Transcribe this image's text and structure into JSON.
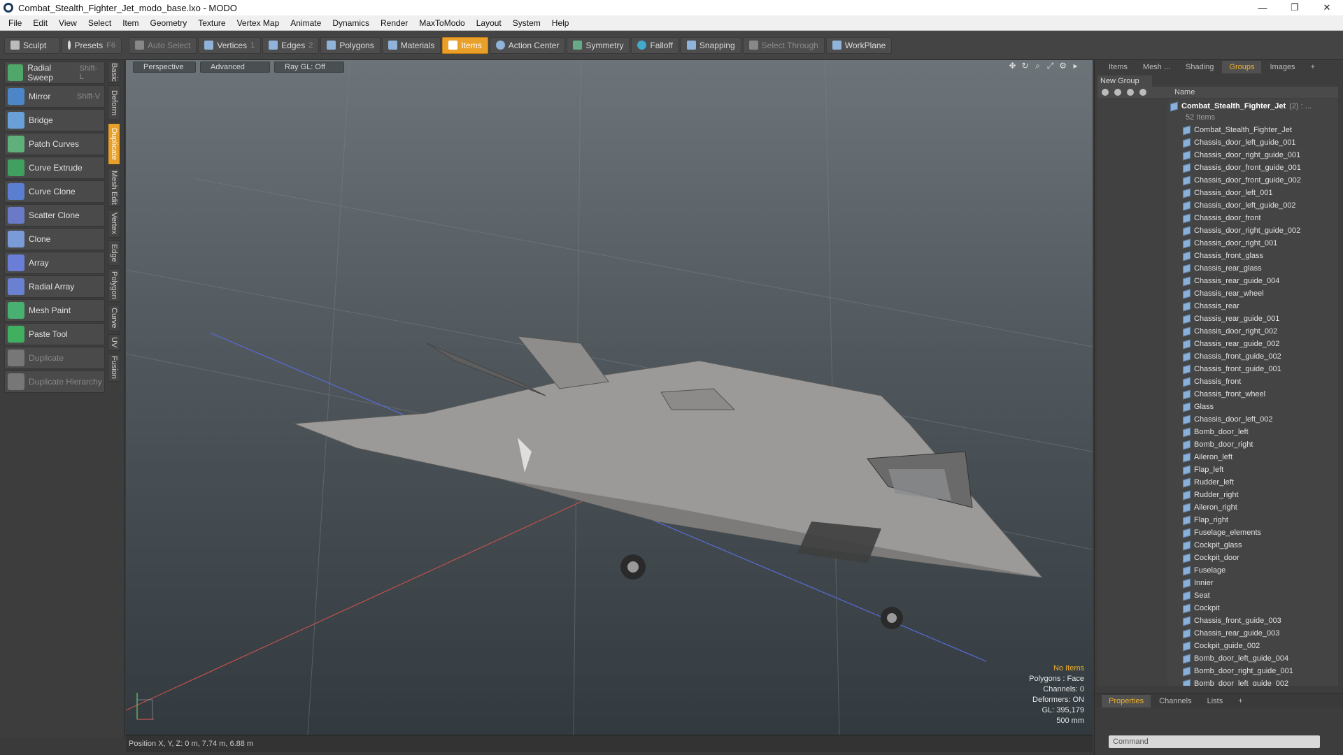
{
  "window": {
    "title": "Combat_Stealth_Fighter_Jet_modo_base.lxo - MODO",
    "min": "—",
    "max": "❐",
    "close": "✕"
  },
  "menu": [
    "File",
    "Edit",
    "View",
    "Select",
    "Item",
    "Geometry",
    "Texture",
    "Vertex Map",
    "Animate",
    "Dynamics",
    "Render",
    "MaxToModo",
    "Layout",
    "System",
    "Help"
  ],
  "toolbar": {
    "sculpt": "Sculpt",
    "presets": "Presets",
    "presets_key": "F6",
    "auto_select": "Auto Select",
    "vertices": "Vertices",
    "vertices_key": "1",
    "edges": "Edges",
    "edges_key": "2",
    "polygons": "Polygons",
    "materials": "Materials",
    "items": "Items",
    "action_center": "Action Center",
    "symmetry": "Symmetry",
    "falloff": "Falloff",
    "snapping": "Snapping",
    "select_through": "Select Through",
    "workplane": "WorkPlane"
  },
  "tools": [
    {
      "label": "Radial Sweep",
      "key": "Shift-L",
      "color": "#4fa86a"
    },
    {
      "label": "Mirror",
      "key": "Shift-V",
      "color": "#4c86c8"
    },
    {
      "label": "Bridge",
      "key": "",
      "color": "#6aa0d8"
    },
    {
      "label": "Patch Curves",
      "key": "",
      "color": "#5fb07a"
    },
    {
      "label": "Curve Extrude",
      "key": "",
      "color": "#3fa060"
    },
    {
      "label": "Curve Clone",
      "key": "",
      "color": "#5a7ed0"
    },
    {
      "label": "Scatter Clone",
      "key": "",
      "color": "#6a7ac8"
    },
    {
      "label": "Clone",
      "key": "",
      "color": "#7a9ad8"
    },
    {
      "label": "Array",
      "key": "",
      "color": "#6a7ed8"
    },
    {
      "label": "Radial Array",
      "key": "",
      "color": "#6a80d0"
    },
    {
      "label": "Mesh Paint",
      "key": "",
      "color": "#48b070"
    },
    {
      "label": "Paste Tool",
      "key": "",
      "color": "#40b060"
    },
    {
      "label": "Duplicate",
      "key": "",
      "color": "#777"
    },
    {
      "label": "Duplicate Hierarchy",
      "key": "",
      "color": "#777"
    }
  ],
  "vtabs": [
    "Basic",
    "Deform",
    "Duplicate",
    "Mesh Edit",
    "Vertex",
    "Edge",
    "Polygon",
    "Curve",
    "UV",
    "Fusion"
  ],
  "viewport": {
    "perspective": "Perspective",
    "advanced": "Advanced",
    "raygl": "Ray GL: Off",
    "info": {
      "no_items": "No Items",
      "polygons": "Polygons : Face",
      "channels": "Channels: 0",
      "deformers": "Deformers: ON",
      "gl": "GL: 395,179",
      "scale": "500 mm"
    }
  },
  "status": {
    "position": "Position X, Y, Z:   0 m, 7.74 m, 6.88 m"
  },
  "right": {
    "tabs": [
      "Items",
      "Mesh ...",
      "Shading",
      "Groups",
      "Images",
      "+"
    ],
    "new_group": "New Group",
    "name_col": "Name",
    "root": "Combat_Stealth_Fighter_Jet",
    "root_count": "(2) : ...",
    "items_count": "52 Items",
    "items": [
      "Combat_Stealth_Fighter_Jet",
      "Chassis_door_left_guide_001",
      "Chassis_door_right_guide_001",
      "Chassis_door_front_guide_001",
      "Chassis_door_front_guide_002",
      "Chassis_door_left_001",
      "Chassis_door_left_guide_002",
      "Chassis_door_front",
      "Chassis_door_right_guide_002",
      "Chassis_door_right_001",
      "Chassis_front_glass",
      "Chassis_rear_glass",
      "Chassis_rear_guide_004",
      "Chassis_rear_wheel",
      "Chassis_rear",
      "Chassis_rear_guide_001",
      "Chassis_door_right_002",
      "Chassis_rear_guide_002",
      "Chassis_front_guide_002",
      "Chassis_front_guide_001",
      "Chassis_front",
      "Chassis_front_wheel",
      "Glass",
      "Chassis_door_left_002",
      "Bomb_door_left",
      "Bomb_door_right",
      "Aileron_left",
      "Flap_left",
      "Rudder_left",
      "Rudder_right",
      "Aileron_right",
      "Flap_right",
      "Fuselage_elements",
      "Cockpit_glass",
      "Cockpit_door",
      "Fuselage",
      "Innier",
      "Seat",
      "Cockpit",
      "Chassis_front_guide_003",
      "Chassis_rear_guide_003",
      "Cockpit_guide_002",
      "Bomb_door_left_guide_004",
      "Bomb_door_right_guide_001",
      "Bomb_door_left_guide_002"
    ],
    "bottom_tabs": [
      "Properties",
      "Channels",
      "Lists",
      "+"
    ],
    "command": "Command"
  }
}
